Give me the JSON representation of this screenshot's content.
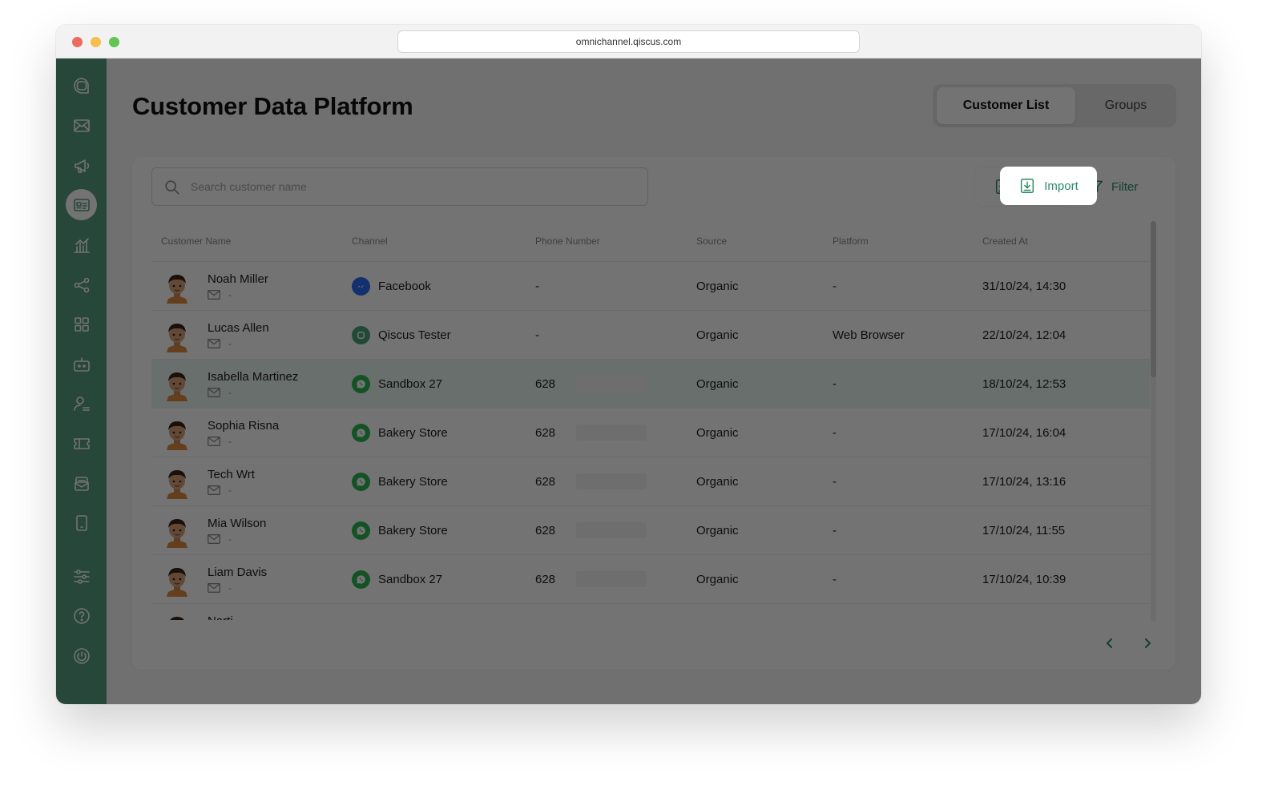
{
  "browser": {
    "url": "omnichannel.qiscus.com"
  },
  "sidebar": {
    "items": [
      {
        "icon": "chat-logo-icon"
      },
      {
        "icon": "inbox-icon"
      },
      {
        "icon": "megaphone-icon"
      },
      {
        "icon": "contact-card-icon",
        "active": true
      },
      {
        "icon": "analytics-chart-icon"
      },
      {
        "icon": "integration-share-icon"
      },
      {
        "icon": "apps-grid-icon"
      },
      {
        "icon": "bot-icon"
      },
      {
        "icon": "agent-user-icon"
      },
      {
        "icon": "ticket-icon"
      },
      {
        "icon": "mailbox-icon"
      },
      {
        "icon": "mobile-device-icon"
      },
      {
        "icon": "settings-sliders-icon"
      },
      {
        "icon": "help-icon"
      },
      {
        "icon": "power-icon"
      }
    ]
  },
  "header": {
    "title": "Customer Data Platform",
    "tabs": {
      "customer_list": "Customer List",
      "groups": "Groups"
    }
  },
  "toolbar": {
    "search_placeholder": "Search customer name",
    "import_label": "Import",
    "filter_label": "Filter"
  },
  "table": {
    "columns": {
      "name": "Customer Name",
      "channel": "Channel",
      "phone": "Phone Number",
      "source": "Source",
      "platform": "Platform",
      "created": "Created At"
    },
    "rows": [
      {
        "name": "Noah Miller",
        "email": "-",
        "channel": "Facebook",
        "channel_type": "messenger",
        "phone": "-",
        "source": "Organic",
        "platform": "-",
        "created": "31/10/24, 14:30"
      },
      {
        "name": "Lucas Allen",
        "email": "-",
        "channel": "Qiscus Tester",
        "channel_type": "qiscus",
        "phone": "-",
        "source": "Organic",
        "platform": "Web Browser",
        "created": "22/10/24, 12:04"
      },
      {
        "name": "Isabella Martinez",
        "email": "-",
        "channel": "Sandbox 27",
        "channel_type": "whatsapp",
        "phone": "628",
        "source": "Organic",
        "platform": "-",
        "created": "18/10/24, 12:53",
        "highlighted": true
      },
      {
        "name": "Sophia Risna",
        "email": "-",
        "channel": "Bakery Store",
        "channel_type": "whatsapp",
        "phone": "628",
        "source": "Organic",
        "platform": "-",
        "created": "17/10/24, 16:04"
      },
      {
        "name": "Tech Wrt",
        "email": "-",
        "channel": "Bakery Store",
        "channel_type": "whatsapp",
        "phone": "628",
        "source": "Organic",
        "platform": "-",
        "created": "17/10/24, 13:16"
      },
      {
        "name": "Mia Wilson",
        "email": "-",
        "channel": "Bakery Store",
        "channel_type": "whatsapp",
        "phone": "628",
        "source": "Organic",
        "platform": "-",
        "created": "17/10/24, 11:55"
      },
      {
        "name": "Liam Davis",
        "email": "-",
        "channel": "Sandbox 27",
        "channel_type": "whatsapp",
        "phone": "628",
        "source": "Organic",
        "platform": "-",
        "created": "17/10/24, 10:39"
      },
      {
        "name": "Narti",
        "email": "",
        "channel": "",
        "channel_type": "",
        "phone": "",
        "source": "",
        "platform": "",
        "created": ""
      }
    ]
  },
  "pagination": {
    "prev_icon": "chevron-left-icon",
    "next_icon": "chevron-right-icon"
  },
  "colors": {
    "sidebar": "#5a9e84",
    "accent": "#2c8a66",
    "messenger": "#2a6df4",
    "whatsapp": "#2eb652",
    "qiscus": "#4aa37c",
    "row_highlight": "#e9f5ef"
  }
}
